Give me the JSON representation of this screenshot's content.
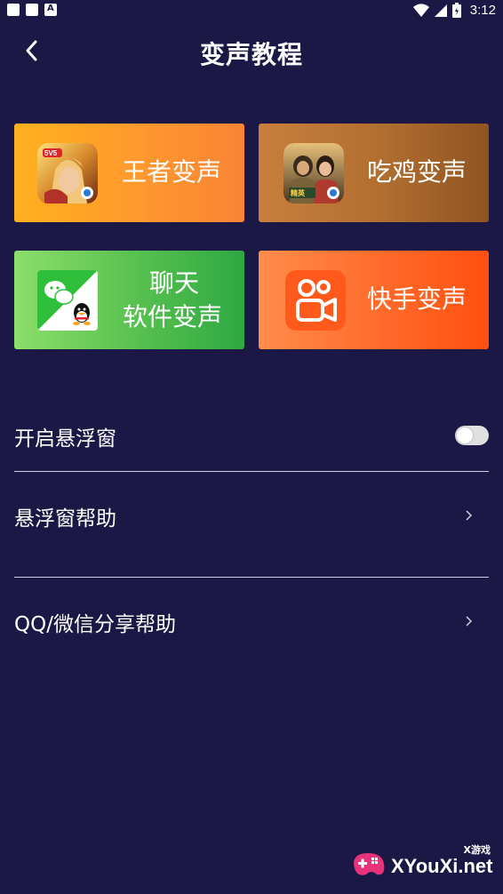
{
  "status_bar": {
    "time": "3:12",
    "icons": [
      "notification-square-icon",
      "notification-square-icon",
      "notification-a-icon",
      "wifi-icon",
      "cell-signal-icon",
      "battery-icon"
    ]
  },
  "header": {
    "title": "变声教程",
    "back_icon": "chevron-left-icon"
  },
  "cards": [
    {
      "id": "wangzhe",
      "label": "王者变声",
      "icon": "honor-of-kings-game-icon",
      "color": "#ffa628"
    },
    {
      "id": "chiji",
      "label": "吃鸡变声",
      "icon": "pubg-game-icon",
      "color": "#b06e30"
    },
    {
      "id": "chat",
      "label_line1": "聊天",
      "label_line2": "软件变声",
      "icon": "wechat-qq-icon",
      "color": "#56c04e"
    },
    {
      "id": "kuaishou",
      "label": "快手变声",
      "icon": "kuaishou-icon",
      "color": "#ff6a2a"
    }
  ],
  "settings": {
    "floating_window": {
      "label": "开启悬浮窗",
      "toggle_on": false
    },
    "floating_help": {
      "label": "悬浮窗帮助"
    },
    "share_help": {
      "label": "QQ/微信分享帮助"
    }
  },
  "watermark": {
    "text": "XYouXi.net",
    "small": "X游戏"
  }
}
